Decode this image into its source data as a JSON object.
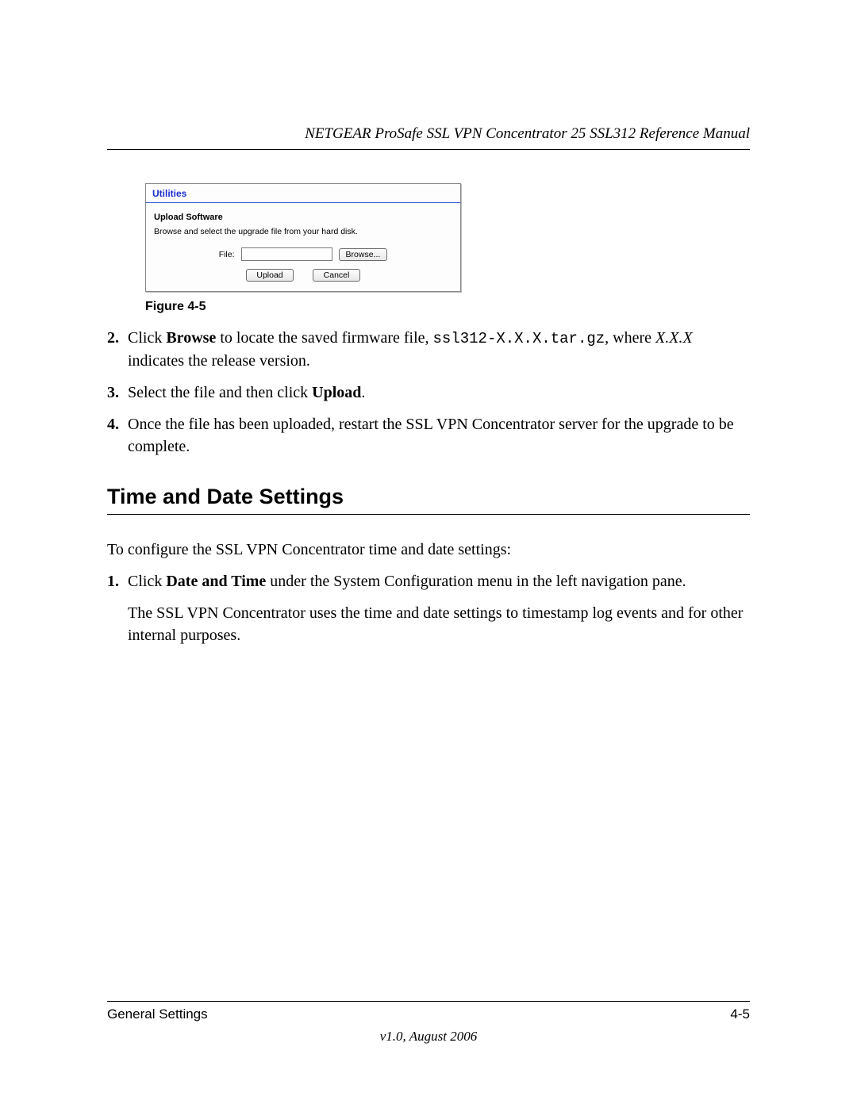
{
  "header": {
    "title": "NETGEAR ProSafe SSL VPN Concentrator 25 SSL312 Reference Manual"
  },
  "utilitiesPanel": {
    "title": "Utilities",
    "subheading": "Upload Software",
    "instruction": "Browse and select the upgrade file from your hard disk.",
    "fileLabel": "File:",
    "fileValue": "",
    "browseButton": "Browse...",
    "uploadButton": "Upload",
    "cancelButton": "Cancel"
  },
  "figureCaption": "Figure 4-5",
  "steps": {
    "s2": {
      "num": "2.",
      "t1": "Click ",
      "bold1": "Browse",
      "t2": " to locate the saved firmware file, ",
      "mono": "ssl312-X.X.X.tar.gz",
      "t3": ", where ",
      "ital": "X.X.X",
      "t4": " indicates the release version."
    },
    "s3": {
      "num": "3.",
      "t1": "Select the file and then click ",
      "bold1": "Upload",
      "t2": "."
    },
    "s4": {
      "num": "4.",
      "t1": "Once the file has been uploaded, restart the SSL VPN Concentrator server for the upgrade to be complete."
    }
  },
  "sectionHeading": "Time and Date Settings",
  "intro": "To configure the SSL VPN Concentrator time and date settings:",
  "steps2": {
    "s1": {
      "num": "1.",
      "t1": "Click ",
      "bold1": "Date and Time",
      "t2": " under the System Configuration menu in the left navigation pane."
    },
    "para": "The SSL VPN Concentrator uses the time and date settings to timestamp log events and for other internal purposes."
  },
  "footer": {
    "left": "General Settings",
    "right": "4-5",
    "version": "v1.0, August 2006"
  }
}
